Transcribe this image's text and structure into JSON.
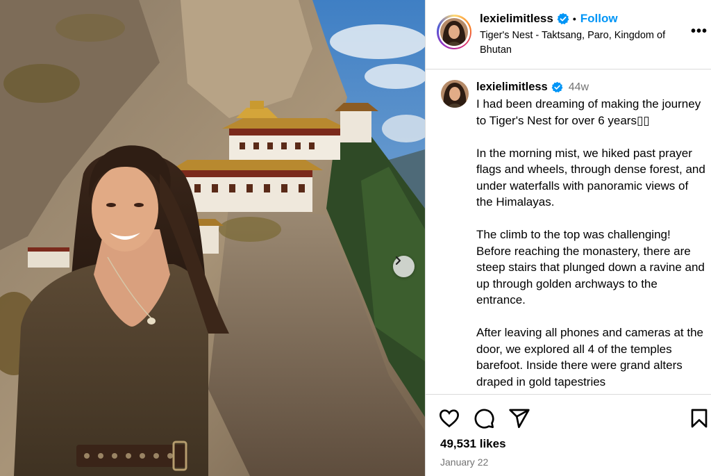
{
  "post": {
    "username": "lexielimitless",
    "follow_label": "Follow",
    "separator": "•",
    "location": "Tiger's Nest - Taktsang, Paro, Kingdom of Bhutan",
    "more_label": "•••"
  },
  "caption": {
    "username": "lexielimitless",
    "time_ago": "44w",
    "paragraphs": [
      "I had been dreaming of making the journey to Tiger's Nest for over 6 years▯▯",
      "In the morning mist, we hiked past prayer flags and wheels, through dense forest, and under waterfalls with panoramic views of the Himalayas.",
      "The climb to the top was challenging! Before reaching the monastery, there are steep stairs that plunged down a ravine and up through golden archways to the entrance.",
      "After leaving all phones and cameras at the door, we explored all 4 of the temples barefoot. Inside there were grand alters draped in gold tapestries"
    ]
  },
  "engagement": {
    "likes": "49,531 likes",
    "date": "January 22"
  },
  "icons": {
    "like": "heart-icon",
    "comment": "comment-icon",
    "share": "share-icon",
    "save": "bookmark-icon",
    "next": "chevron-right-icon",
    "verified": "verified-badge-icon"
  },
  "colors": {
    "accent": "#0095f6",
    "muted": "#737373",
    "border": "#dbdbdb"
  }
}
